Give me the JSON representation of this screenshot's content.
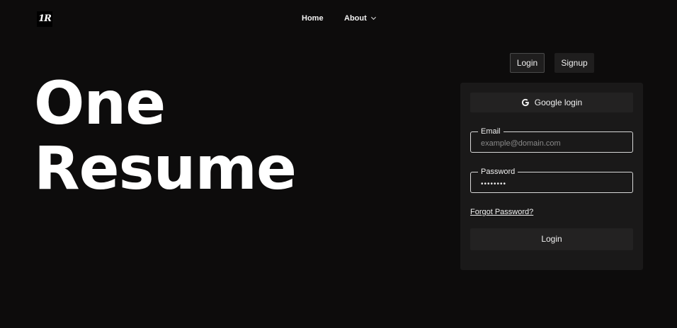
{
  "header": {
    "logo_text": "1R",
    "nav": {
      "home": "Home",
      "about": "About"
    }
  },
  "hero": {
    "line1": "One",
    "line2": "Resume"
  },
  "auth_tabs": {
    "login": "Login",
    "signup": "Signup",
    "active": "login"
  },
  "form": {
    "google_label": "Google login",
    "email": {
      "label": "Email",
      "placeholder": "example@domain.com",
      "value": ""
    },
    "password": {
      "label": "Password",
      "value": "********"
    },
    "forgot_label": "Forgot Password?",
    "submit_label": "Login"
  },
  "colors": {
    "background": "#0d0c0c",
    "card": "#1a1919",
    "button": "#232222",
    "text": "#ffffff"
  }
}
